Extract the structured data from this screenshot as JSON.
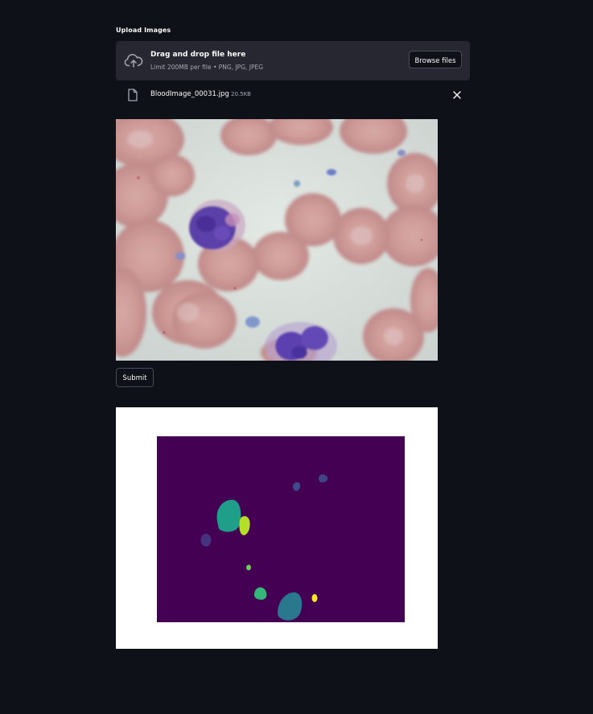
{
  "uploader": {
    "label": "Upload Images",
    "dropzone_title": "Drag and drop file here",
    "dropzone_subtitle": "Limit 200MB per file • PNG, JPG, JPEG",
    "browse_label": "Browse files",
    "icon": "cloud-upload-icon"
  },
  "uploaded_file": {
    "name": "BloodImage_00031.jpg",
    "size": "20.5KB",
    "icon": "file-icon",
    "remove_icon": "close-icon"
  },
  "submit": {
    "label": "Submit"
  },
  "colors": {
    "background": "#0e1117",
    "panel": "#262730",
    "mask_background": "#440154",
    "mask_purple": "#46337e",
    "mask_blue": "#365c8d",
    "mask_teal": "#277f8e",
    "mask_green": "#1fa187",
    "mask_lime": "#4ac16d",
    "mask_yellowgreen": "#a0da39",
    "mask_yellow": "#fde725"
  }
}
